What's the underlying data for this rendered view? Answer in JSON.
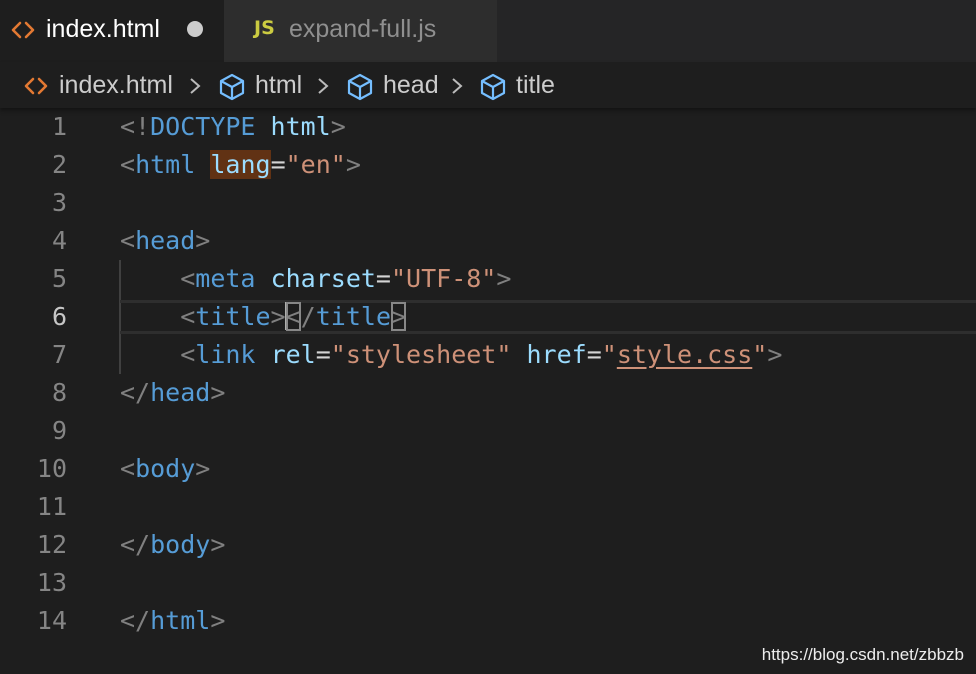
{
  "tabs": [
    {
      "label": "index.html",
      "icon": "html-file-icon",
      "active": true,
      "dirty": true
    },
    {
      "label": "expand-full.js",
      "icon_text": "JS",
      "active": false
    }
  ],
  "breadcrumb": {
    "file": "index.html",
    "items": [
      "html",
      "head",
      "title"
    ]
  },
  "editor": {
    "current_line": 6,
    "line_numbers": [
      "1",
      "2",
      "3",
      "4",
      "5",
      "6",
      "7",
      "8",
      "9",
      "10",
      "11",
      "12",
      "13",
      "14"
    ],
    "lines": [
      {
        "tokens": [
          [
            "<!",
            "punc"
          ],
          [
            "DOCTYPE",
            "tag"
          ],
          [
            " ",
            "plain"
          ],
          [
            "html",
            "attr"
          ],
          [
            ">",
            "punc"
          ]
        ]
      },
      {
        "tokens": [
          [
            "<",
            "punc"
          ],
          [
            "html",
            "tag"
          ],
          [
            " ",
            "plain"
          ],
          [
            "lang",
            "attr-hl"
          ],
          [
            "=",
            "eq"
          ],
          [
            "\"en\"",
            "str"
          ],
          [
            ">",
            "punc"
          ]
        ]
      },
      {
        "tokens": []
      },
      {
        "tokens": [
          [
            "<",
            "punc"
          ],
          [
            "head",
            "tag"
          ],
          [
            ">",
            "punc"
          ]
        ]
      },
      {
        "tokens": [
          [
            "    ",
            "plain"
          ],
          [
            "<",
            "punc"
          ],
          [
            "meta",
            "tag"
          ],
          [
            " ",
            "plain"
          ],
          [
            "charset",
            "attr"
          ],
          [
            "=",
            "eq"
          ],
          [
            "\"UTF-8\"",
            "str"
          ],
          [
            ">",
            "punc"
          ]
        ]
      },
      {
        "tokens": [
          [
            "    ",
            "plain"
          ],
          [
            "<",
            "punc"
          ],
          [
            "title",
            "tag"
          ],
          [
            ">",
            "punc"
          ],
          [
            "<",
            "punc-match"
          ],
          [
            "/",
            "punc"
          ],
          [
            "title",
            "tag"
          ],
          [
            ">",
            "punc-match"
          ]
        ]
      },
      {
        "tokens": [
          [
            "    ",
            "plain"
          ],
          [
            "<",
            "punc"
          ],
          [
            "link",
            "tag"
          ],
          [
            " ",
            "plain"
          ],
          [
            "rel",
            "attr"
          ],
          [
            "=",
            "eq"
          ],
          [
            "\"stylesheet\"",
            "str"
          ],
          [
            " ",
            "plain"
          ],
          [
            "href",
            "attr"
          ],
          [
            "=",
            "eq"
          ],
          [
            "\"",
            "str"
          ],
          [
            "style.css",
            "str-link"
          ],
          [
            "\"",
            "str"
          ],
          [
            ">",
            "punc"
          ]
        ]
      },
      {
        "tokens": [
          [
            "</",
            "punc"
          ],
          [
            "head",
            "tag"
          ],
          [
            ">",
            "punc"
          ]
        ]
      },
      {
        "tokens": []
      },
      {
        "tokens": [
          [
            "<",
            "punc"
          ],
          [
            "body",
            "tag"
          ],
          [
            ">",
            "punc"
          ]
        ]
      },
      {
        "tokens": []
      },
      {
        "tokens": [
          [
            "</",
            "punc"
          ],
          [
            "body",
            "tag"
          ],
          [
            ">",
            "punc"
          ]
        ]
      },
      {
        "tokens": []
      },
      {
        "tokens": [
          [
            "</",
            "punc"
          ],
          [
            "html",
            "tag"
          ],
          [
            ">",
            "punc"
          ]
        ]
      }
    ]
  },
  "watermark": "https://blog.csdn.net/zbbzb",
  "colors": {
    "background": "#1e1e1e",
    "tag": "#569cd6",
    "attribute": "#9cdcfe",
    "string": "#ce9178",
    "punctuation": "#808080",
    "html_icon": "#e37933",
    "js_icon": "#cbcb41"
  }
}
